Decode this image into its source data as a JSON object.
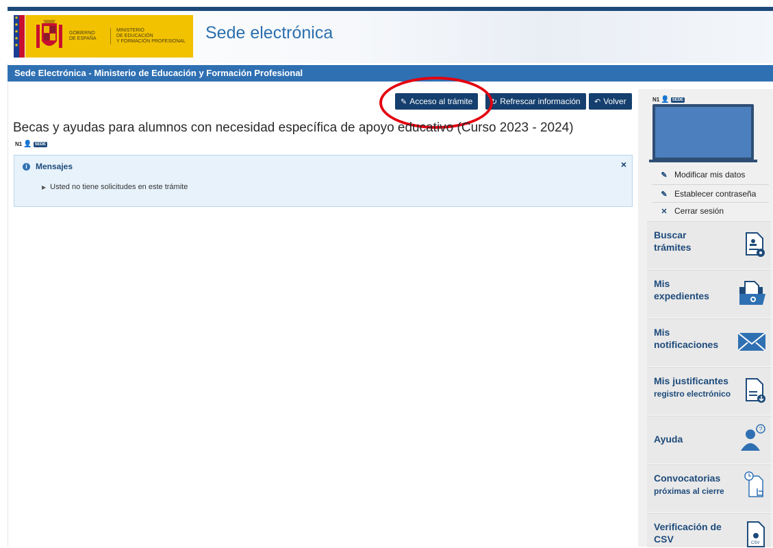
{
  "header": {
    "gov_line1": "Gobierno",
    "gov_line2": "de España",
    "ministry_line1": "Ministerio",
    "ministry_line2": "de Educación",
    "ministry_line3": "y Formación Profesional",
    "site_title": "Sede electrónica"
  },
  "nav_bar": {
    "title": "Sede Electrónica - Ministerio de Educación y Formación Profesional"
  },
  "actions": {
    "access": "Acceso al trámite",
    "refresh": "Refrescar información",
    "back": "Volver"
  },
  "page": {
    "title": "Becas y ayudas para alumnos con necesidad específica de apoyo educativo (Curso 2023 - 2024)",
    "level": "N1",
    "badge": "SEDE"
  },
  "messages": {
    "heading": "Mensajes",
    "close": "×",
    "items": [
      "Usted no tiene solicitudes en este trámite"
    ]
  },
  "sidebar": {
    "level": "N1",
    "badge": "SEDE",
    "user_links": [
      "Modificar mis datos",
      "Establecer contraseña",
      "Cerrar sesión"
    ],
    "cards": [
      {
        "line1": "Buscar",
        "line2": "trámites"
      },
      {
        "line1": "Mis",
        "line2": "expedientes"
      },
      {
        "line1": "Mis",
        "line2": "notificaciones"
      },
      {
        "line1": "Mis justificantes",
        "line2": "registro electrónico"
      },
      {
        "line1": "Ayuda",
        "line2": ""
      },
      {
        "line1": "Convocatorias",
        "line2": "próximas al cierre"
      },
      {
        "line1": "Verificación de",
        "line2": "CSV"
      }
    ],
    "csv_icon_label": "CSV"
  },
  "colors": {
    "brand_blue": "#2f70b3",
    "dark_blue": "#143f6e",
    "gov_yellow": "#f2c200",
    "highlight_red": "#e3000f"
  }
}
